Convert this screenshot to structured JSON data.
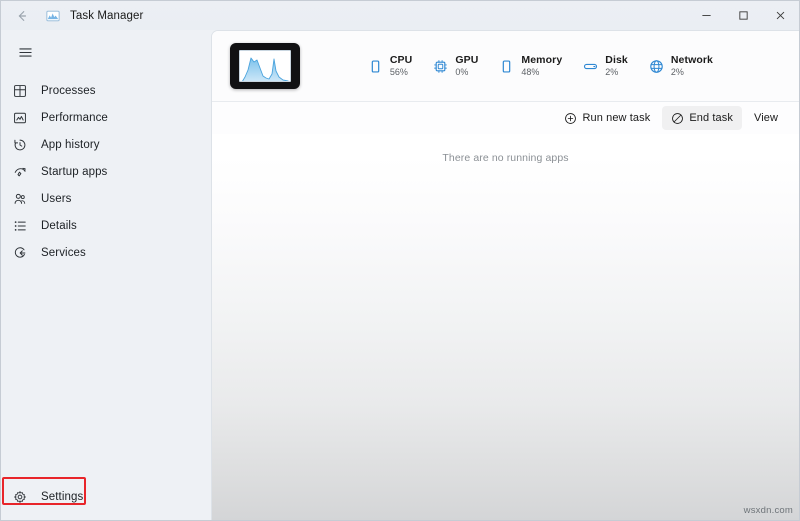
{
  "window": {
    "title": "Task Manager",
    "back_icon": "back-arrow-icon",
    "app_icon": "task-manager-icon",
    "controls": {
      "minimize": "–",
      "maximize": "☐",
      "close": "✕"
    }
  },
  "sidebar": {
    "hamburger_icon": "hamburger-menu-icon",
    "items": [
      {
        "label": "Processes",
        "icon": "processes-icon"
      },
      {
        "label": "Performance",
        "icon": "performance-icon"
      },
      {
        "label": "App history",
        "icon": "app-history-icon"
      },
      {
        "label": "Startup apps",
        "icon": "startup-apps-icon"
      },
      {
        "label": "Users",
        "icon": "users-icon"
      },
      {
        "label": "Details",
        "icon": "details-icon"
      },
      {
        "label": "Services",
        "icon": "services-icon"
      }
    ],
    "settings": {
      "label": "Settings",
      "icon": "gear-icon"
    },
    "highlight_color": "#e8252a"
  },
  "header": {
    "thumbnail_icon": "task-manager-graph-thumbnail",
    "accent_color": "#2f88d3",
    "stats": [
      {
        "name": "CPU",
        "value": "56%",
        "icon": "cpu-icon"
      },
      {
        "name": "GPU",
        "value": "0%",
        "icon": "gpu-chip-icon"
      },
      {
        "name": "Memory",
        "value": "48%",
        "icon": "memory-icon"
      },
      {
        "name": "Disk",
        "value": "2%",
        "icon": "disk-icon"
      },
      {
        "name": "Network",
        "value": "2%",
        "icon": "network-globe-icon"
      }
    ]
  },
  "toolbar": {
    "run_new_task": {
      "label": "Run new task",
      "icon": "plus-circle-icon"
    },
    "end_task": {
      "label": "End task",
      "icon": "ban-circle-icon"
    },
    "view": {
      "label": "View"
    }
  },
  "content": {
    "empty_message": "There are no running apps"
  },
  "watermark": "wsxdn.com"
}
